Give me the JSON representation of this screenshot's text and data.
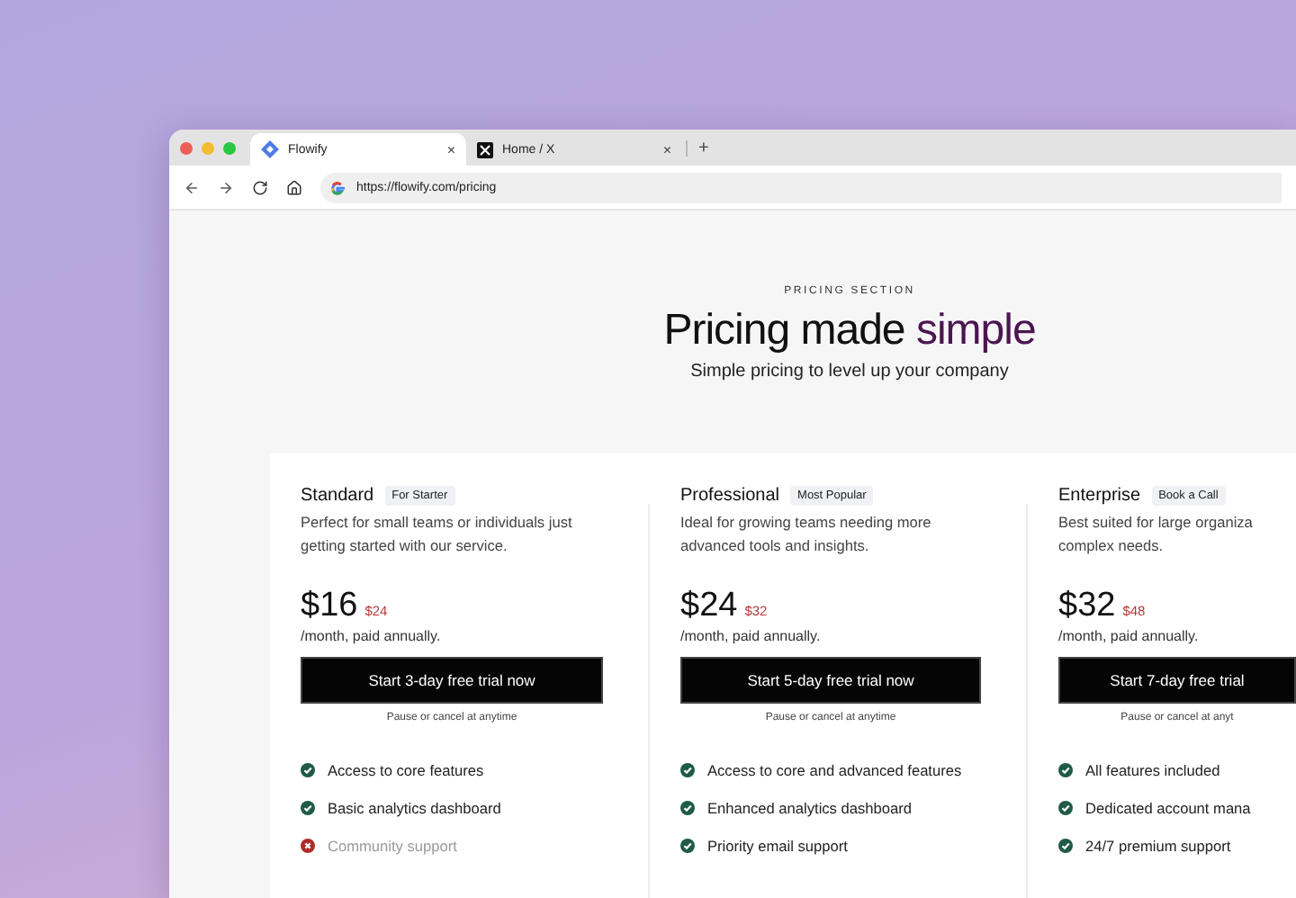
{
  "browser": {
    "tabs": [
      {
        "title": "Flowify",
        "kind": "flowify",
        "close": "×",
        "selected": true
      },
      {
        "title": "Home / X",
        "kind": "x",
        "close": "×",
        "selected": false
      }
    ],
    "new_tab": "+",
    "address": "https://flowify.com/pricing"
  },
  "header": {
    "eyebrow": "PRICING SECTION",
    "title": "Pricing made",
    "title_accent": "simple",
    "subtitle": "Simple pricing to level up your company"
  },
  "plans": [
    {
      "name": "Standard",
      "badge": "For Starter",
      "description": "Perfect for small teams or individuals just getting started with our service.",
      "price": "$16",
      "old_price": "$24",
      "period": "/month, paid annually.",
      "cta": "Start 3-day free trial now",
      "note": "Pause or cancel at anytime",
      "features": [
        {
          "text": "Access to core features",
          "included": true
        },
        {
          "text": "Basic analytics dashboard",
          "included": true
        },
        {
          "text": "Community support",
          "included": false
        }
      ]
    },
    {
      "name": "Professional",
      "badge": "Most Popular",
      "description": "Ideal for growing teams needing more advanced tools and insights.",
      "price": "$24",
      "old_price": "$32",
      "period": "/month, paid annually.",
      "cta": "Start 5-day free trial now",
      "note": "Pause or cancel at anytime",
      "features": [
        {
          "text": "Access to core and advanced features",
          "included": true
        },
        {
          "text": "Enhanced analytics dashboard",
          "included": true
        },
        {
          "text": "Priority email support",
          "included": true
        }
      ]
    },
    {
      "name": "Enterprise",
      "badge": "Book a Call",
      "description": "Best suited for large organiza complex needs.",
      "price": "$32",
      "old_price": "$48",
      "period": "/month, paid annually.",
      "cta": "Start 7-day free trial",
      "note": "Pause or cancel at anyt",
      "features": [
        {
          "text": "All features included",
          "included": true
        },
        {
          "text": "Dedicated account mana",
          "included": true
        },
        {
          "text": "24/7 premium support",
          "included": true
        }
      ]
    }
  ]
}
